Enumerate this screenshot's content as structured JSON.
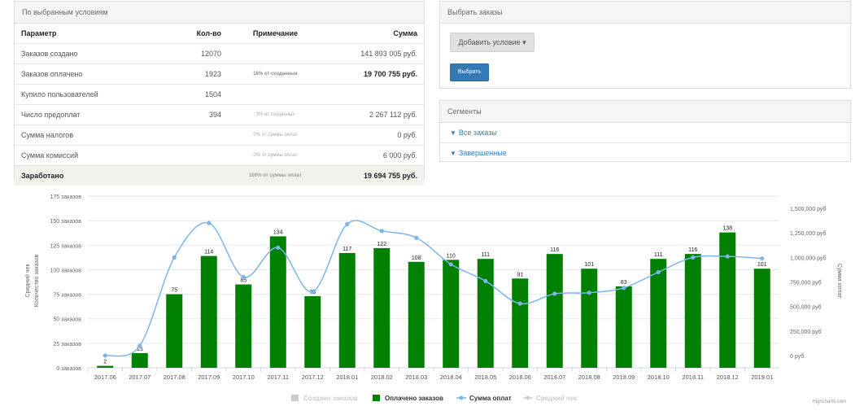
{
  "stats_panel": {
    "title": "По выбранным условиям",
    "headers": [
      "Параметр",
      "Кол-во",
      "Примечание",
      "Сумма"
    ],
    "rows": [
      {
        "param": "Заказов создано",
        "count": "12070",
        "note": "",
        "sum": "141 893 005 руб."
      },
      {
        "param": "Заказов оплачено",
        "count": "1923",
        "note": "16% от созданных",
        "sum": "19 700 755 руб."
      },
      {
        "param": "Купило пользователей",
        "count": "1504",
        "note": "",
        "sum": ""
      },
      {
        "param": "Число предоплат",
        "count": "394",
        "note": "3% от созданных",
        "sum": "2 267 112 руб."
      },
      {
        "param": "Сумма налогов",
        "count": "",
        "note": "0% от суммы оплат",
        "sum": "0 руб."
      },
      {
        "param": "Сумма комиссий",
        "count": "",
        "note": "0% от суммы оплат",
        "sum": "6 000 руб."
      },
      {
        "param": "Заработано",
        "count": "",
        "note": "100% от суммы оплат",
        "sum": "19 694 755 руб."
      }
    ]
  },
  "select_panel": {
    "title": "Выбрать заказы",
    "add_condition_label": "Добавить условие ▾",
    "select_label": "Выбрать"
  },
  "segments_panel": {
    "title": "Сегменты",
    "items": [
      "Все заказы",
      "Завершенные"
    ]
  },
  "credits": "Highcharts.com",
  "colors": {
    "bars": "#008000",
    "line": "#7cb5ec",
    "grid": "#e6e6e6",
    "primary": "#337ab7"
  },
  "chart_data": {
    "type": "bar",
    "categories": [
      "2017.06",
      "2017.07",
      "2017.08",
      "2017.09",
      "2017.10",
      "2017.11",
      "2017.12",
      "2018.01",
      "2018.02",
      "2018.03",
      "2018.04",
      "2018.05",
      "2018.06",
      "2018.07",
      "2018.08",
      "2018.09",
      "2018.10",
      "2018.11",
      "2018.12",
      "2019.01"
    ],
    "series": [
      {
        "name": "Создано заказов",
        "visible": false,
        "values": []
      },
      {
        "name": "Оплачено заказов",
        "axis": "left",
        "values": [
          2,
          15,
          75,
          114,
          85,
          134,
          73,
          117,
          122,
          108,
          110,
          111,
          91,
          116,
          101,
          83,
          111,
          116,
          138,
          101
        ]
      },
      {
        "name": "Сумма оплат",
        "axis": "right",
        "values": [
          0,
          100000,
          1000000,
          1350000,
          800000,
          1100000,
          650000,
          1340000,
          1270000,
          1200000,
          930000,
          760000,
          530000,
          630000,
          640000,
          690000,
          850000,
          1000000,
          1010000,
          990000
        ]
      },
      {
        "name": "Средний чек",
        "visible": false,
        "values": []
      }
    ],
    "left_axis": {
      "labels": [
        "Количество заказов",
        "Средний чек"
      ],
      "ylim": [
        0,
        175
      ],
      "ticks": [
        0,
        25,
        50,
        75,
        100,
        125,
        150,
        175
      ],
      "tick_labels": [
        "0 заказов",
        "25 заказов",
        "50 заказов",
        "75 заказов",
        "100 заказов",
        "125 заказов",
        "150 заказов",
        "175 заказов"
      ]
    },
    "right_axis": {
      "label": "Сумма оплат",
      "ylim": [
        -125000,
        1625000
      ],
      "ticks": [
        0,
        250000,
        500000,
        750000,
        1000000,
        1250000,
        1500000
      ],
      "tick_labels": [
        "0 руб",
        "250,000 руб",
        "500,000 руб",
        "750,000 руб",
        "1,000,000 руб",
        "1,250,000 руб",
        "1,500,000 руб"
      ]
    },
    "grid": true,
    "legend": "bottom-center"
  }
}
